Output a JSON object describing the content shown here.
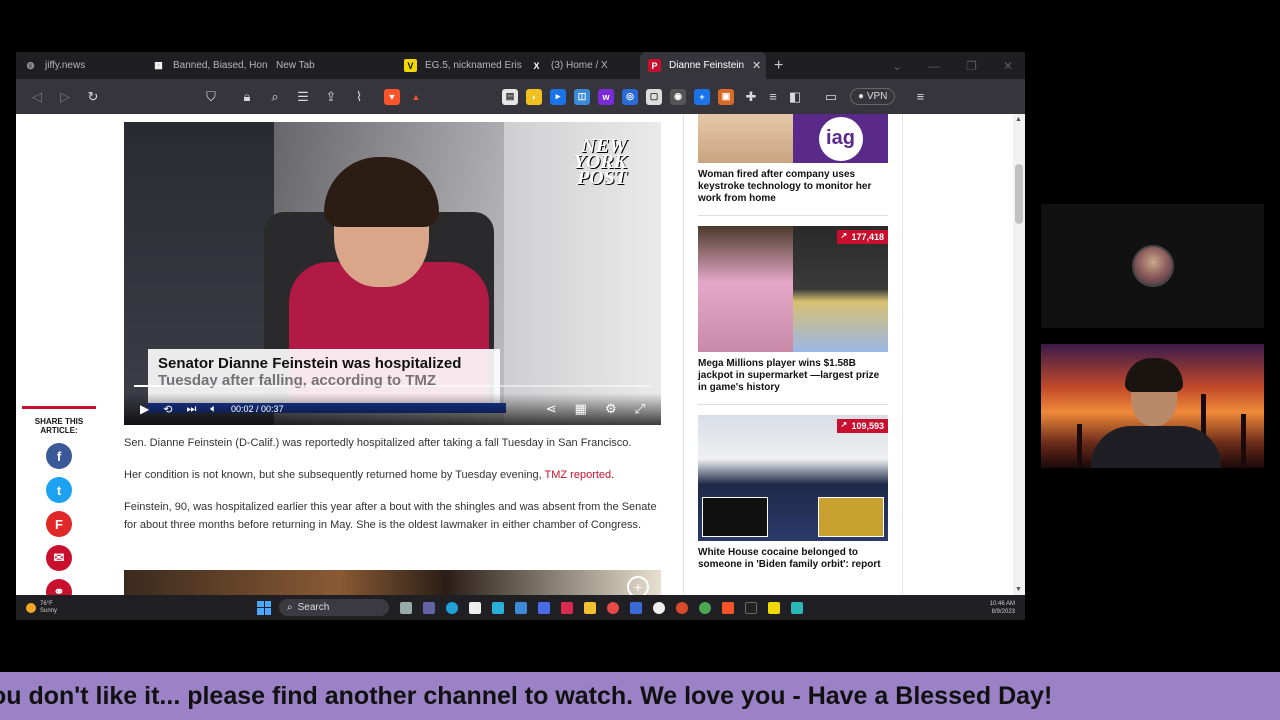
{
  "browser": {
    "tabs": [
      {
        "label": "jiffy.news",
        "icon": "globe-icon",
        "color": "#777777",
        "glyph": "◍"
      },
      {
        "label": "Banned, Biased, Hone",
        "icon": "bbh-icon",
        "color": "#ffffff",
        "glyph": "▦"
      },
      {
        "label": "New Tab",
        "icon": "",
        "color": "",
        "glyph": ""
      },
      {
        "label": "EG.5, nicknamed Eris",
        "icon": "v-icon",
        "color": "#f0d800",
        "glyph": "V"
      },
      {
        "label": "(3) Home / X",
        "icon": "x-icon",
        "color": "#ffffff",
        "glyph": "X"
      },
      {
        "label": "Dianne Feinstein",
        "icon": "nypost-icon",
        "color": "#c8102e",
        "glyph": "P",
        "active": true
      }
    ],
    "new_tab_symbol": "+",
    "close_symbol": "✕",
    "vpn_label": "● VPN"
  },
  "video": {
    "watermark_line1": "NEW",
    "watermark_line2": "YORK",
    "watermark_line3": "POST",
    "caption_line1": "Senator Dianne Feinstein was hospitalized",
    "caption_line2": "Tuesday after falling, according to TMZ",
    "time_current": "00:02",
    "time_sep": "/",
    "time_total": "00:37",
    "progress": 0.06
  },
  "share": {
    "label": "SHARE THIS ARTICLE:",
    "buttons": [
      {
        "name": "facebook",
        "glyph": "f",
        "color": "#3b5998"
      },
      {
        "name": "twitter",
        "glyph": "t",
        "color": "#1da1f2"
      },
      {
        "name": "flipboard",
        "glyph": "F",
        "color": "#e12828"
      },
      {
        "name": "email",
        "glyph": "✉",
        "color": "#c8102e"
      },
      {
        "name": "link",
        "glyph": "⚭",
        "color": "#c8102e"
      }
    ]
  },
  "article": {
    "p1": "Sen. Dianne Feinstein (D-Calif.) was reportedly hospitalized after taking a fall Tuesday in San Francisco.",
    "p2_text": "Her condition is not known, but she subsequently returned home by Tuesday evening, ",
    "p2_link": "TMZ reported",
    "p2_end": ".",
    "p3": "Feinstein, 90, was hospitalized earlier this year after a bout with the shingles and was absent from the Senate for about three months before returning in May. She is the oldest lawmaker in either chamber of Congress."
  },
  "sidebar": {
    "items": [
      {
        "title": "Woman fired after company uses keystroke technology to monitor her work from home",
        "badge": "",
        "logo": "iag"
      },
      {
        "title": "Mega Millions player wins $1.58B jackpot in supermarket —largest prize in game's history",
        "badge": "177,418"
      },
      {
        "title": "White House cocaine belonged to someone in 'Biden family orbit': report",
        "badge": "109,593"
      }
    ]
  },
  "taskbar": {
    "weather_temp": "76°F",
    "weather_desc": "Sunny",
    "search_label": "Search",
    "time": "10:46 AM",
    "date": "8/9/2023"
  },
  "ticker": {
    "text": "ou don't like it... please find another channel to watch. We love you - Have a Blessed Day!"
  }
}
